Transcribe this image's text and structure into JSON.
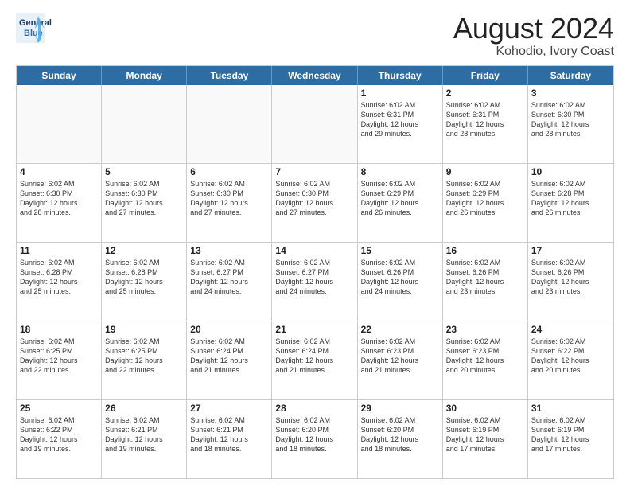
{
  "header": {
    "logo_line1": "General",
    "logo_line2": "Blue",
    "title": "August 2024",
    "subtitle": "Kohodio, Ivory Coast"
  },
  "day_names": [
    "Sunday",
    "Monday",
    "Tuesday",
    "Wednesday",
    "Thursday",
    "Friday",
    "Saturday"
  ],
  "weeks": [
    [
      {
        "day": "",
        "content": "",
        "empty": true
      },
      {
        "day": "",
        "content": "",
        "empty": true
      },
      {
        "day": "",
        "content": "",
        "empty": true
      },
      {
        "day": "",
        "content": "",
        "empty": true
      },
      {
        "day": "1",
        "content": "Sunrise: 6:02 AM\nSunset: 6:31 PM\nDaylight: 12 hours\nand 29 minutes.",
        "empty": false
      },
      {
        "day": "2",
        "content": "Sunrise: 6:02 AM\nSunset: 6:31 PM\nDaylight: 12 hours\nand 28 minutes.",
        "empty": false
      },
      {
        "day": "3",
        "content": "Sunrise: 6:02 AM\nSunset: 6:30 PM\nDaylight: 12 hours\nand 28 minutes.",
        "empty": false
      }
    ],
    [
      {
        "day": "4",
        "content": "Sunrise: 6:02 AM\nSunset: 6:30 PM\nDaylight: 12 hours\nand 28 minutes.",
        "empty": false
      },
      {
        "day": "5",
        "content": "Sunrise: 6:02 AM\nSunset: 6:30 PM\nDaylight: 12 hours\nand 27 minutes.",
        "empty": false
      },
      {
        "day": "6",
        "content": "Sunrise: 6:02 AM\nSunset: 6:30 PM\nDaylight: 12 hours\nand 27 minutes.",
        "empty": false
      },
      {
        "day": "7",
        "content": "Sunrise: 6:02 AM\nSunset: 6:30 PM\nDaylight: 12 hours\nand 27 minutes.",
        "empty": false
      },
      {
        "day": "8",
        "content": "Sunrise: 6:02 AM\nSunset: 6:29 PM\nDaylight: 12 hours\nand 26 minutes.",
        "empty": false
      },
      {
        "day": "9",
        "content": "Sunrise: 6:02 AM\nSunset: 6:29 PM\nDaylight: 12 hours\nand 26 minutes.",
        "empty": false
      },
      {
        "day": "10",
        "content": "Sunrise: 6:02 AM\nSunset: 6:28 PM\nDaylight: 12 hours\nand 26 minutes.",
        "empty": false
      }
    ],
    [
      {
        "day": "11",
        "content": "Sunrise: 6:02 AM\nSunset: 6:28 PM\nDaylight: 12 hours\nand 25 minutes.",
        "empty": false
      },
      {
        "day": "12",
        "content": "Sunrise: 6:02 AM\nSunset: 6:28 PM\nDaylight: 12 hours\nand 25 minutes.",
        "empty": false
      },
      {
        "day": "13",
        "content": "Sunrise: 6:02 AM\nSunset: 6:27 PM\nDaylight: 12 hours\nand 24 minutes.",
        "empty": false
      },
      {
        "day": "14",
        "content": "Sunrise: 6:02 AM\nSunset: 6:27 PM\nDaylight: 12 hours\nand 24 minutes.",
        "empty": false
      },
      {
        "day": "15",
        "content": "Sunrise: 6:02 AM\nSunset: 6:26 PM\nDaylight: 12 hours\nand 24 minutes.",
        "empty": false
      },
      {
        "day": "16",
        "content": "Sunrise: 6:02 AM\nSunset: 6:26 PM\nDaylight: 12 hours\nand 23 minutes.",
        "empty": false
      },
      {
        "day": "17",
        "content": "Sunrise: 6:02 AM\nSunset: 6:26 PM\nDaylight: 12 hours\nand 23 minutes.",
        "empty": false
      }
    ],
    [
      {
        "day": "18",
        "content": "Sunrise: 6:02 AM\nSunset: 6:25 PM\nDaylight: 12 hours\nand 22 minutes.",
        "empty": false
      },
      {
        "day": "19",
        "content": "Sunrise: 6:02 AM\nSunset: 6:25 PM\nDaylight: 12 hours\nand 22 minutes.",
        "empty": false
      },
      {
        "day": "20",
        "content": "Sunrise: 6:02 AM\nSunset: 6:24 PM\nDaylight: 12 hours\nand 21 minutes.",
        "empty": false
      },
      {
        "day": "21",
        "content": "Sunrise: 6:02 AM\nSunset: 6:24 PM\nDaylight: 12 hours\nand 21 minutes.",
        "empty": false
      },
      {
        "day": "22",
        "content": "Sunrise: 6:02 AM\nSunset: 6:23 PM\nDaylight: 12 hours\nand 21 minutes.",
        "empty": false
      },
      {
        "day": "23",
        "content": "Sunrise: 6:02 AM\nSunset: 6:23 PM\nDaylight: 12 hours\nand 20 minutes.",
        "empty": false
      },
      {
        "day": "24",
        "content": "Sunrise: 6:02 AM\nSunset: 6:22 PM\nDaylight: 12 hours\nand 20 minutes.",
        "empty": false
      }
    ],
    [
      {
        "day": "25",
        "content": "Sunrise: 6:02 AM\nSunset: 6:22 PM\nDaylight: 12 hours\nand 19 minutes.",
        "empty": false
      },
      {
        "day": "26",
        "content": "Sunrise: 6:02 AM\nSunset: 6:21 PM\nDaylight: 12 hours\nand 19 minutes.",
        "empty": false
      },
      {
        "day": "27",
        "content": "Sunrise: 6:02 AM\nSunset: 6:21 PM\nDaylight: 12 hours\nand 18 minutes.",
        "empty": false
      },
      {
        "day": "28",
        "content": "Sunrise: 6:02 AM\nSunset: 6:20 PM\nDaylight: 12 hours\nand 18 minutes.",
        "empty": false
      },
      {
        "day": "29",
        "content": "Sunrise: 6:02 AM\nSunset: 6:20 PM\nDaylight: 12 hours\nand 18 minutes.",
        "empty": false
      },
      {
        "day": "30",
        "content": "Sunrise: 6:02 AM\nSunset: 6:19 PM\nDaylight: 12 hours\nand 17 minutes.",
        "empty": false
      },
      {
        "day": "31",
        "content": "Sunrise: 6:02 AM\nSunset: 6:19 PM\nDaylight: 12 hours\nand 17 minutes.",
        "empty": false
      }
    ]
  ]
}
